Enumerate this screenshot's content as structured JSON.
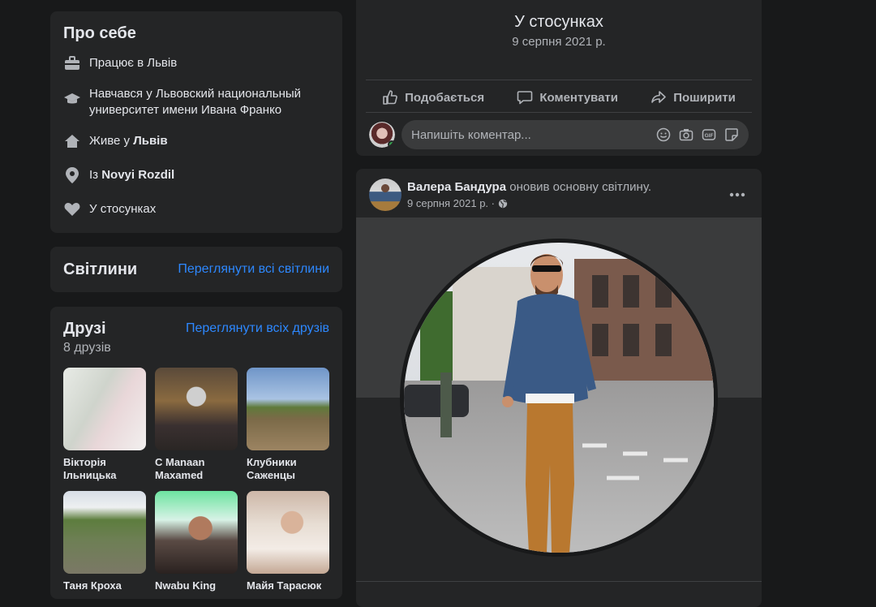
{
  "about": {
    "title": "Про себе",
    "work": "Працює в Львів",
    "education": "Навчався у Львовский национальный университет имени Ивана Франко",
    "lives_prefix": "Живе у",
    "lives_city": "Львів",
    "from_prefix": "Із",
    "from_city": "Novyi Rozdil",
    "relationship": "У стосунках"
  },
  "photos": {
    "title": "Світлини",
    "see_all": "Переглянути всі світлини"
  },
  "friends": {
    "title": "Друзі",
    "count": "8 друзів",
    "see_all": "Переглянути всіх друзів",
    "items": [
      {
        "name": "Вікторія Ільницька"
      },
      {
        "name": "С Manaan Maxamed"
      },
      {
        "name": "Клубники Саженцы"
      },
      {
        "name": "Таня Кроха"
      },
      {
        "name": "Nwabu King"
      },
      {
        "name": "Майя Тарасюк"
      }
    ]
  },
  "post1": {
    "status": "У стосунках",
    "date": "9 серпня 2021 р.",
    "like": "Подобається",
    "comment": "Коментувати",
    "share": "Поширити",
    "comment_placeholder": "Напишіть коментар..."
  },
  "post2": {
    "author": "Валера Бандура",
    "action": "оновив основну світлину.",
    "date": "9 серпня 2021 р. ·"
  },
  "colors": {
    "background": "#18191a",
    "card": "#242526",
    "link": "#2d88ff",
    "online": "#31a24c"
  }
}
